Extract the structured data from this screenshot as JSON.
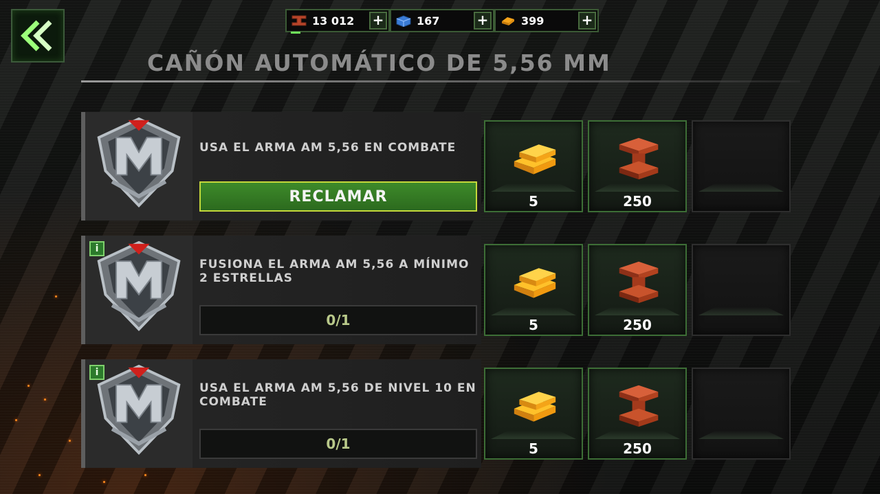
{
  "header": {
    "title": "CAÑÓN AUTOMÁTICO DE 5,56 MM",
    "back_icon": "double-chevron-left-icon"
  },
  "resources": [
    {
      "icon": "steel-beam-icon",
      "value": "13 012",
      "plus": "+"
    },
    {
      "icon": "blue-crate-icon",
      "value": "167",
      "plus": "+"
    },
    {
      "icon": "gold-bars-icon",
      "value": "399",
      "plus": "+"
    }
  ],
  "missions": [
    {
      "description": "USA EL ARMA AM 5,56 EN COMBATE",
      "action_label": "RECLAMAR",
      "has_info": false,
      "rewards": [
        {
          "icon": "gold-bars-icon",
          "amount": "5"
        },
        {
          "icon": "steel-beam-icon",
          "amount": "250"
        }
      ]
    },
    {
      "description": "FUSIONA EL ARMA AM 5,56 A MÍNIMO 2 ESTRELLAS",
      "progress": "0/1",
      "has_info": true,
      "info_label": "i",
      "rewards": [
        {
          "icon": "gold-bars-icon",
          "amount": "5"
        },
        {
          "icon": "steel-beam-icon",
          "amount": "250"
        }
      ]
    },
    {
      "description": "USA EL ARMA AM 5,56 DE NIVEL 10 EN COMBATE",
      "progress": "0/1",
      "has_info": true,
      "info_label": "i",
      "rewards": [
        {
          "icon": "gold-bars-icon",
          "amount": "5"
        },
        {
          "icon": "steel-beam-icon",
          "amount": "250"
        }
      ]
    }
  ],
  "colors": {
    "accent_green": "#3d8a2a",
    "claim_border": "#c4d83a",
    "gold": "#f5a31a",
    "steel": "#b8452a"
  }
}
